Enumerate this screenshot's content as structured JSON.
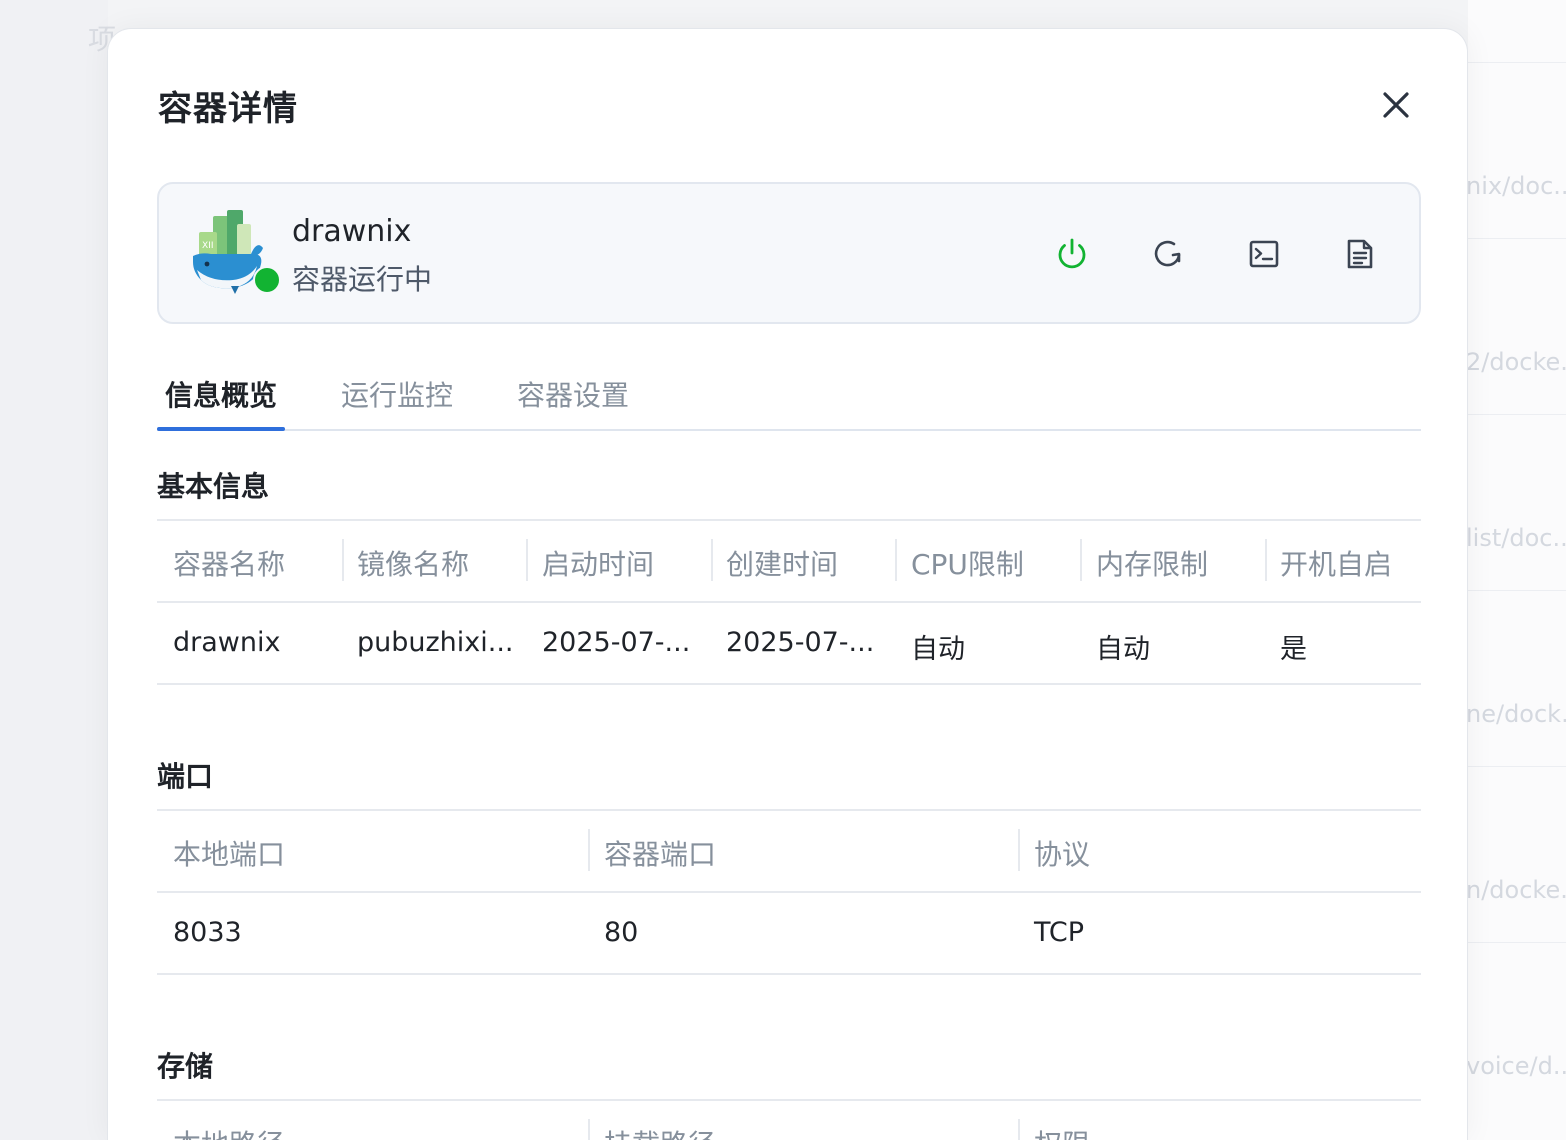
{
  "background": {
    "left_char": "项",
    "right_links": [
      "nix/doc...",
      "2/docke...",
      "list/doc...",
      "ne/dock...",
      "n/docke...",
      "voice/d..."
    ]
  },
  "modal": {
    "title": "容器详情",
    "close_icon": "close-icon"
  },
  "container": {
    "name": "drawnix",
    "status": "容器运行中",
    "status_color": "#12b332",
    "actions": [
      {
        "name": "power-button",
        "icon": "power-icon",
        "color": "#12b332"
      },
      {
        "name": "restart-button",
        "icon": "restart-icon",
        "color": "#3b4452"
      },
      {
        "name": "terminal-button",
        "icon": "terminal-icon",
        "color": "#3b4452"
      },
      {
        "name": "logs-button",
        "icon": "document-icon",
        "color": "#3b4452"
      }
    ]
  },
  "tabs": [
    {
      "label": "信息概览",
      "active": true
    },
    {
      "label": "运行监控",
      "active": false
    },
    {
      "label": "容器设置",
      "active": false
    }
  ],
  "accent_color": "#2f6fdc",
  "basic_info": {
    "title": "基本信息",
    "headers": [
      "容器名称",
      "镜像名称",
      "启动时间",
      "创建时间",
      "CPU限制",
      "内存限制",
      "开机自启"
    ],
    "rows": [
      [
        "drawnix",
        "pubuzhixi...",
        "2025-07-...",
        "2025-07-...",
        "自动",
        "自动",
        "是"
      ]
    ]
  },
  "ports": {
    "title": "端口",
    "headers": [
      "本地端口",
      "容器端口",
      "协议"
    ],
    "rows": [
      [
        "8033",
        "80",
        "TCP"
      ]
    ]
  },
  "storage": {
    "title": "存储",
    "headers": [
      "本地路径",
      "挂载路径",
      "权限"
    ]
  }
}
